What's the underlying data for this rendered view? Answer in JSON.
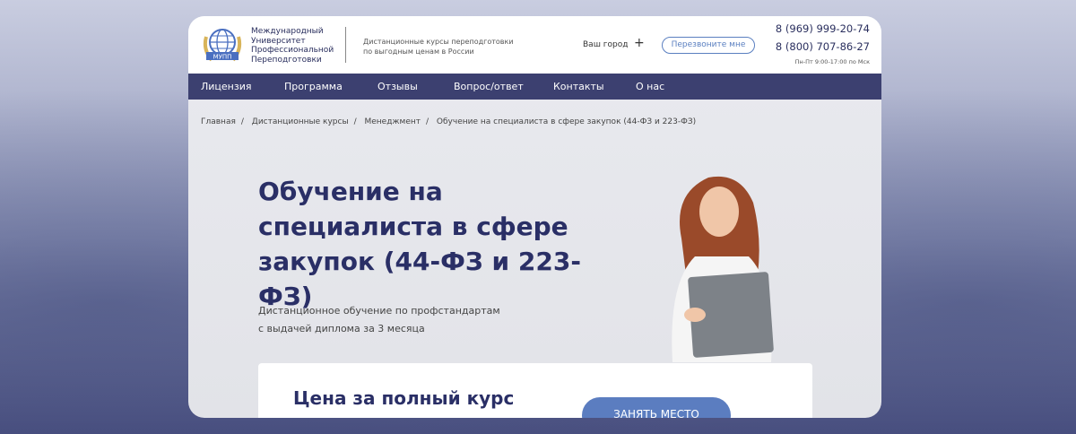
{
  "header": {
    "logo_text": "МУПП",
    "university": "Международный Университет Профессиональной Переподготовки",
    "tagline_1": "Дистанционные курсы переподготовки",
    "tagline_2": "по выгодным ценам в России",
    "city": "Ваш город",
    "callback": "Перезвоните мне",
    "phone_1": "8 (969) 999-20-74",
    "phone_2": "8 (800) 707-86-27",
    "hours": "Пн-Пт 9:00-17:00 по Мск"
  },
  "nav": [
    "Лицензия",
    "Программа",
    "Отзывы",
    "Вопрос/ответ",
    "Контакты",
    "О нас"
  ],
  "breadcrumbs": [
    "Главная",
    "Дистанционные курсы",
    "Менеджмент",
    "Обучение на специалиста в сфере закупок (44-ФЗ и 223-ФЗ)"
  ],
  "hero": {
    "title": "Обучение на специалиста в сфере закупок (44-ФЗ и 223-ФЗ)",
    "sub_1": "Дистанционное обучение по профстандартам",
    "sub_2": "с выдачей диплома за 3 месяца"
  },
  "price": {
    "title": "Цена за полный курс",
    "button": "ЗАНЯТЬ МЕСТО"
  }
}
